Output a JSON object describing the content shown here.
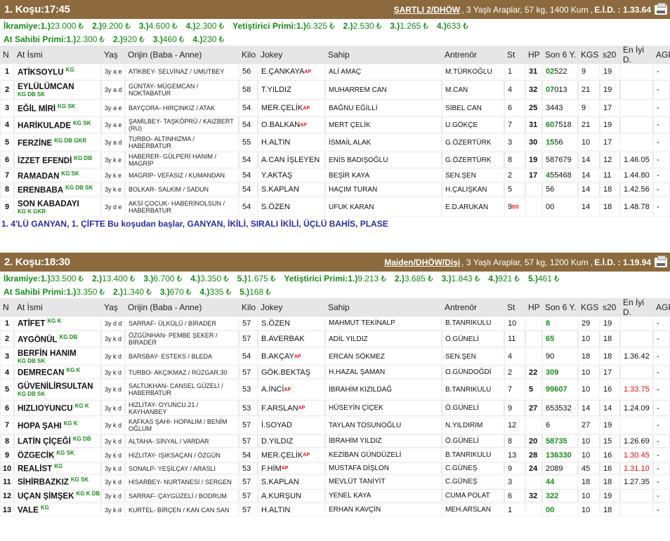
{
  "columns": {
    "n": "N",
    "name": "At İsmi",
    "age": "Yaş",
    "origin": "Orijin (Baba - Anne)",
    "weight": "Kilo",
    "jockey": "Jokey",
    "owner": "Sahip",
    "trainer": "Antrenör",
    "st": "St",
    "hp": "HP",
    "last6": "Son 6 Y.",
    "kgs": "KGS",
    "s20": "s20",
    "best": "En İyi D.",
    "agf": "AGF"
  },
  "currency": "₺",
  "races": [
    {
      "title": "1. Koşu:17:45",
      "condition": "ŞARTLI 2/DHÖW",
      "details": ", 3 Yaşlı Araplar, 57 kg, 1400 Kum ,",
      "eid": "E.İ.D. : 1.33.64",
      "prize_label": "İkramiye:",
      "prizes": [
        {
          "k": "1.)",
          "v": "23.000"
        },
        {
          "k": "2.)",
          "v": "9.200"
        },
        {
          "k": "3.)",
          "v": "4.600"
        },
        {
          "k": "4.)",
          "v": "2.300"
        }
      ],
      "breeder_label": "Yetiştirici Primi:",
      "breeder": [
        {
          "k": "1.)",
          "v": "6.325"
        },
        {
          "k": "2.)",
          "v": "2.530"
        },
        {
          "k": "3.)",
          "v": "1.265"
        },
        {
          "k": "4.)",
          "v": "633"
        }
      ],
      "owner_label": "At Sahibi Primi:",
      "owner": [
        {
          "k": "1.)",
          "v": "2.300"
        },
        {
          "k": "2.)",
          "v": "920"
        },
        {
          "k": "3.)",
          "v": "460"
        },
        {
          "k": "4.)",
          "v": "230"
        }
      ],
      "bets": "1. 4'LÜ GANYAN, 1. ÇİFTE Bu koşudan başlar, GANYAN, İKİLİ, SIRALI İKİLİ, ÜÇLÜ BAHİS, PLASE",
      "horses": [
        {
          "n": "1",
          "name": "ATİKSOYLU",
          "tag": "KG",
          "tag_nl": false,
          "age": "3y a e",
          "origin": "ATİKBEY- SELVİNAZ / UMUTBEY",
          "kilo": "56",
          "jockey": "E.ÇANKAYA",
          "ap": "AP",
          "owner": "ALİ AMAÇ",
          "trainer": "M.TÜRKOĞLU",
          "st": "1",
          "ds": "",
          "hp": "31",
          "son6_g": "02",
          "son6": "522",
          "kgs": "9",
          "s20": "19",
          "best": "",
          "best_red": false,
          "agf": "-"
        },
        {
          "n": "2",
          "name": "EYLÜLÜMCAN",
          "tag": "KG DB SK",
          "tag_nl": true,
          "age": "3y a d",
          "origin": "GÜNTAY- MÜGEMCAN / NOKTABATUR",
          "kilo": "58",
          "jockey": "T.YILDIZ",
          "ap": "",
          "owner": "MUHARREM CAN",
          "trainer": "M.CAN",
          "st": "4",
          "ds": "",
          "hp": "32",
          "son6_g": "07",
          "son6": "013",
          "kgs": "21",
          "s20": "19",
          "best": "",
          "best_red": false,
          "agf": "-"
        },
        {
          "n": "3",
          "name": "EĞİL MİRİ",
          "tag": "KG SK",
          "tag_nl": false,
          "age": "3y a e",
          "origin": "BAYÇORA- HIRÇINKIZ / ATAK",
          "kilo": "54",
          "jockey": "MER.ÇELİK",
          "ap": "AP",
          "owner": "BAĞNU EĞİLLİ",
          "trainer": "SİBEL CAN",
          "st": "6",
          "ds": "",
          "hp": "25",
          "son6_g": "",
          "son6": "3443",
          "kgs": "9",
          "s20": "17",
          "best": "",
          "best_red": false,
          "agf": "-"
        },
        {
          "n": "4",
          "name": "HARİKULADE",
          "tag": "KG SK",
          "tag_nl": false,
          "age": "3y a e",
          "origin": "ŞAMİLBEY- TAŞKÖPRÜ / KAIZBERT (RU)",
          "kilo": "54",
          "jockey": "O.BALKAN",
          "ap": "AP",
          "owner": "MERT ÇELİK",
          "trainer": "U.GÖKÇE",
          "st": "7",
          "ds": "",
          "hp": "31",
          "son6_g": "60",
          "son6": "7518",
          "kgs": "21",
          "s20": "19",
          "best": "",
          "best_red": false,
          "agf": "-"
        },
        {
          "n": "5",
          "name": "FERZİNE",
          "tag": "KG DB GKR",
          "tag_nl": false,
          "age": "3y a d",
          "origin": "TURBO- ALTINHIZMA / HABERBATUR",
          "kilo": "55",
          "jockey": "H.ALTIN",
          "ap": "",
          "owner": "İSMAİL ALAK",
          "trainer": "G.ÖZERTÜRK",
          "st": "3",
          "ds": "",
          "hp": "30",
          "son6_g": "15",
          "son6": "56",
          "kgs": "10",
          "s20": "17",
          "best": "",
          "best_red": false,
          "agf": "-"
        },
        {
          "n": "6",
          "name": "İZZET EFENDİ",
          "tag": "KG DB",
          "tag_nl": false,
          "age": "3y k e",
          "origin": "HABERER- GÜLPERİ HANIM / MAGRİP",
          "kilo": "54",
          "jockey": "A.CAN İŞLEYEN",
          "ap": "",
          "owner": "ENİS BADIŞOĞLU",
          "trainer": "G.ÖZERTÜRK",
          "st": "8",
          "ds": "",
          "hp": "19",
          "son6_g": "",
          "son6": "587679",
          "kgs": "14",
          "s20": "12",
          "best": "1.46.05",
          "best_red": false,
          "agf": "-"
        },
        {
          "n": "7",
          "name": "RAMADAN",
          "tag": "KG SK",
          "tag_nl": false,
          "age": "3y k e",
          "origin": "MAGRİP- VEFASIZ / KUMANDAN",
          "kilo": "54",
          "jockey": "Y.AKTAŞ",
          "ap": "",
          "owner": "BEŞİR KAYA",
          "trainer": "SEN.ŞEN",
          "st": "2",
          "ds": "",
          "hp": "17",
          "son6_g": "4",
          "son6": "55468",
          "kgs": "14",
          "s20": "11",
          "best": "1.44.80",
          "best_red": false,
          "agf": "-"
        },
        {
          "n": "8",
          "name": "ERENBABA",
          "tag": "KG DB SK",
          "tag_nl": false,
          "age": "3y k e",
          "origin": "BOLKAR- SALKIM / SADUN",
          "kilo": "54",
          "jockey": "S.KAPLAN",
          "ap": "",
          "owner": "HAÇIM TURAN",
          "trainer": "H.ÇALIŞKAN",
          "st": "5",
          "ds": "",
          "hp": "",
          "son6_g": "",
          "son6": "56",
          "kgs": "14",
          "s20": "18",
          "best": "1.42.56",
          "best_red": false,
          "agf": "-"
        },
        {
          "n": "9",
          "name": "SON KABADAYI",
          "tag": "KG K GKR",
          "tag_nl": true,
          "age": "3y d e",
          "origin": "AKSİ ÇOCUK- HABERİNOLSUN / HABERBATUR",
          "kilo": "54",
          "jockey": "S.ÖZEN",
          "ap": "",
          "owner": "UFUK KARAN",
          "trainer": "E.D.ARUKAN",
          "st": "9",
          "ds": "DS",
          "hp": "",
          "son6_g": "",
          "son6": "00",
          "kgs": "14",
          "s20": "18",
          "best": "1.48.78",
          "best_red": false,
          "agf": "-"
        }
      ]
    },
    {
      "title": "2. Koşu:18:30",
      "condition": "Maiden/DHÖW/Dişi",
      "details": ", 3 Yaşlı Araplar, 57 kg, 1200 Kum ,",
      "eid": "E.İ.D. : 1.19.94",
      "prize_label": "İkramiye:",
      "prizes": [
        {
          "k": "1.)",
          "v": "33.500"
        },
        {
          "k": "2.)",
          "v": "13.400"
        },
        {
          "k": "3.)",
          "v": "6.700"
        },
        {
          "k": "4.)",
          "v": "3.350"
        },
        {
          "k": "5.)",
          "v": "1.675"
        }
      ],
      "breeder_label": "Yetiştirici Primi:",
      "breeder": [
        {
          "k": "1.)",
          "v": "9.213"
        },
        {
          "k": "2.)",
          "v": "3.685"
        },
        {
          "k": "3.)",
          "v": "1.843"
        },
        {
          "k": "4.)",
          "v": "921"
        },
        {
          "k": "5.)",
          "v": "461"
        }
      ],
      "owner_label": "At Sahibi Primi:",
      "owner": [
        {
          "k": "1.)",
          "v": "3.350"
        },
        {
          "k": "2.)",
          "v": "1.340"
        },
        {
          "k": "3.)",
          "v": "670"
        },
        {
          "k": "4.)",
          "v": "335"
        },
        {
          "k": "5.)",
          "v": "168"
        }
      ],
      "bets": "",
      "horses": [
        {
          "n": "1",
          "name": "ATİFET",
          "tag": "KG K",
          "tag_nl": false,
          "age": "3y d d",
          "origin": "SARRAF- ÜLKÜLÜ / BİRADER",
          "kilo": "57",
          "jockey": "S.ÖZEN",
          "ap": "",
          "owner": "MAHMUT TEKİNALP",
          "trainer": "B.TANRIKULU",
          "st": "10",
          "ds": "",
          "hp": "",
          "son6_g": "8",
          "son6": "",
          "kgs": "29",
          "s20": "19",
          "best": "",
          "best_red": false,
          "agf": "-"
        },
        {
          "n": "2",
          "name": "AYGÖNÜL",
          "tag": "KG DB",
          "tag_nl": false,
          "age": "3y k d",
          "origin": "ÖZGÜNHAN- PEMBE ŞEKER / BİRADER",
          "kilo": "57",
          "jockey": "B.AVERBAK",
          "ap": "",
          "owner": "ADİL YILDIZ",
          "trainer": "Ö.GÜNELİ",
          "st": "11",
          "ds": "",
          "hp": "",
          "son6_g": "65",
          "son6": "",
          "kgs": "10",
          "s20": "18",
          "best": "",
          "best_red": false,
          "agf": "-"
        },
        {
          "n": "3",
          "name": "BERFİN HANIM",
          "tag": "KG DB SK",
          "tag_nl": true,
          "age": "3y k d",
          "origin": "BARSBAY- ESTEKS / BLEDA",
          "kilo": "54",
          "jockey": "B.AKÇAY",
          "ap": "AP",
          "owner": "ERCAN SÖKMEZ",
          "trainer": "SEN.ŞEN",
          "st": "4",
          "ds": "",
          "hp": "",
          "son6_g": "",
          "son6": "90",
          "kgs": "18",
          "s20": "18",
          "best": "1.36.42",
          "best_red": false,
          "agf": "-"
        },
        {
          "n": "4",
          "name": "DEMRECAN",
          "tag": "KG K",
          "tag_nl": false,
          "age": "3y k d",
          "origin": "TURBO- AKÇIKMAZ / RÜZGAR.30",
          "kilo": "57",
          "jockey": "GÖK.BEKTAŞ",
          "ap": "",
          "owner": "H.HAZAL ŞAMAN",
          "trainer": "O.GÜNDOĞDİ",
          "st": "2",
          "ds": "",
          "hp": "22",
          "son6_g": "309",
          "son6": "",
          "kgs": "10",
          "s20": "17",
          "best": "",
          "best_red": false,
          "agf": "-"
        },
        {
          "n": "5",
          "name": "GÜVENİLİRSULTAN",
          "tag": "KG DB SK",
          "tag_nl": true,
          "age": "3y k d",
          "origin": "SALTUKHAN- CANSEL GÜZELİ / HABERBATUR",
          "kilo": "53",
          "jockey": "A.İNCİ",
          "ap": "AP",
          "owner": "İBRAHİM KIZILDAĞ",
          "trainer": "B.TANRIKULU",
          "st": "7",
          "ds": "",
          "hp": "5",
          "son6_g": "99607",
          "son6": "",
          "kgs": "10",
          "s20": "16",
          "best": "1.33.75",
          "best_red": true,
          "agf": "-"
        },
        {
          "n": "6",
          "name": "HIZLIOYUNCU",
          "tag": "KG K",
          "tag_nl": false,
          "age": "3y k d",
          "origin": "HIZLITAY- OYUNCU.21 / KAYHANBEY",
          "kilo": "53",
          "jockey": "F.ARSLAN",
          "ap": "AP",
          "owner": "HÜSEYİN ÇİÇEK",
          "trainer": "Ö.GÜNELİ",
          "st": "9",
          "ds": "",
          "hp": "27",
          "son6_g": "",
          "son6": "653532",
          "kgs": "14",
          "s20": "14",
          "best": "1.24.09",
          "best_red": false,
          "agf": "-"
        },
        {
          "n": "7",
          "name": "HOPA ŞAHI",
          "tag": "KG K",
          "tag_nl": false,
          "age": "3y k d",
          "origin": "KAFKAS ŞAHI- HOPALIM / BENİM OĞLUM",
          "kilo": "57",
          "jockey": "İ.SOYAD",
          "ap": "",
          "owner": "TAYLAN TOSUNOĞLU",
          "trainer": "N.YILDIRIM",
          "st": "12",
          "ds": "",
          "hp": "",
          "son6_g": "",
          "son6": "6",
          "kgs": "27",
          "s20": "19",
          "best": "",
          "best_red": false,
          "agf": "-"
        },
        {
          "n": "8",
          "name": "LATİN ÇİÇEĞİ",
          "tag": "KG DB",
          "tag_nl": false,
          "age": "3y k d",
          "origin": "ALTAHA- SİNYAL / VARDAR",
          "kilo": "57",
          "jockey": "D.YILDIZ",
          "ap": "",
          "owner": "İBRAHİM YILDIZ",
          "trainer": "Ö.GÜNELİ",
          "st": "8",
          "ds": "",
          "hp": "20",
          "son6_g": "58735",
          "son6": "",
          "kgs": "10",
          "s20": "15",
          "best": "1.26.69",
          "best_red": false,
          "agf": "-"
        },
        {
          "n": "9",
          "name": "ÖZGECİK",
          "tag": "KG SK",
          "tag_nl": false,
          "age": "3y k d",
          "origin": "HIZLITAY- IŞIKSAÇAN / ÖZGÜN",
          "kilo": "54",
          "jockey": "MER.ÇELİK",
          "ap": "AP",
          "owner": "KEZİBAN GÜNDÜZELİ",
          "trainer": "B.TANRIKULU",
          "st": "13",
          "ds": "",
          "hp": "28",
          "son6_g": "136330",
          "son6": "",
          "kgs": "10",
          "s20": "16",
          "best": "1.30.45",
          "best_red": true,
          "agf": "-"
        },
        {
          "n": "10",
          "name": "REALİST",
          "tag": "KG",
          "tag_nl": false,
          "age": "3y k d",
          "origin": "SONALP- YEŞİLÇAY / ARASLI",
          "kilo": "53",
          "jockey": "F.HİM",
          "ap": "AP",
          "owner": "MUSTAFA DİŞLON",
          "trainer": "C.GÜNEŞ",
          "st": "9",
          "ds": "",
          "hp": "24",
          "son6_g": "",
          "son6": "2089",
          "kgs": "45",
          "s20": "16",
          "best": "1.31.10",
          "best_red": true,
          "agf": "-"
        },
        {
          "n": "11",
          "name": "SİHİRBAZKIZ",
          "tag": "KG SK",
          "tag_nl": false,
          "age": "3y k d",
          "origin": "HİSARBEY- NURTANESİ / SERGEN",
          "kilo": "57",
          "jockey": "S.KAPLAN",
          "ap": "",
          "owner": "MEVLÜT TANİYİT",
          "trainer": "C.GÜNEŞ",
          "st": "3",
          "ds": "",
          "hp": "",
          "son6_g": "44",
          "son6": "",
          "kgs": "18",
          "s20": "18",
          "best": "1.27.35",
          "best_red": false,
          "agf": "-"
        },
        {
          "n": "12",
          "name": "UÇAN ŞİMŞEK",
          "tag": "KG K DB",
          "tag_nl": false,
          "age": "3y k d",
          "origin": "SARRAF- ÇAYGÜZELİ / BODRUM",
          "kilo": "57",
          "jockey": "A.KURŞUN",
          "ap": "",
          "owner": "YENEL KAYA",
          "trainer": "CUMA POLAT",
          "st": "6",
          "ds": "",
          "hp": "32",
          "son6_g": "322",
          "son6": "",
          "kgs": "10",
          "s20": "19",
          "best": "",
          "best_red": false,
          "agf": "-"
        },
        {
          "n": "13",
          "name": "VALE",
          "tag": "KG",
          "tag_nl": false,
          "age": "3y k d",
          "origin": "KURTEL- BİRÇEN / KAN CAN SAN",
          "kilo": "57",
          "jockey": "H.ALTIN",
          "ap": "",
          "owner": "ERHAN KAVÇİN",
          "trainer": "MEH.ARSLAN",
          "st": "1",
          "ds": "",
          "hp": "",
          "son6_g": "00",
          "son6": "",
          "kgs": "10",
          "s20": "18",
          "best": "",
          "best_red": false,
          "agf": "-"
        }
      ]
    }
  ]
}
